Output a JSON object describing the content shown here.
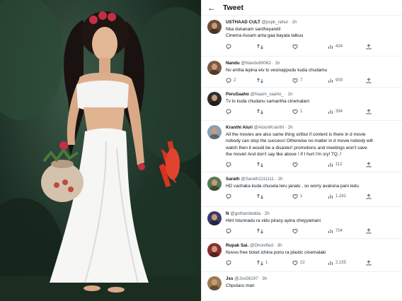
{
  "header": {
    "back_icon": "back-arrow-icon",
    "title": "Tweet"
  },
  "tweets": [
    {
      "name": "USTHAAD CULT",
      "handle": "@pspk_rahul",
      "time": "1h",
      "lines": [
        "Nka dukanam sardheyandi!",
        "Cinema Assam anta gaa bayata talkuu"
      ],
      "replies": "",
      "retweets": "",
      "likes": "",
      "views": "404",
      "avatar_color": "#6b4f3a"
    },
    {
      "name": "Nandu",
      "handle": "@Nandu80062",
      "time": "1h",
      "lines": [
        "Nv entha lepina etv lo vesinappudu kuda chudamu"
      ],
      "replies": "2",
      "retweets": "",
      "likes": "7",
      "views": "909",
      "avatar_color": "#7a5a44"
    },
    {
      "name": "PeruSaaho",
      "handle": "@Naam_saaho_",
      "time": "1h",
      "lines": [
        "Tv lo kuda chudanu samantha cinemalani"
      ],
      "replies": "",
      "retweets": "",
      "likes": "1",
      "views": "394",
      "avatar_color": "#2e2e2e"
    },
    {
      "name": "Kranthi Aluri",
      "handle": "@AlooriKranthi",
      "time": "2h",
      "lines": [
        "All the movies are also same thing sirlbut if content is there in d movie",
        "nobody can stop the success! Otherwise no matter in d movie nobody will",
        "watch then it would be a disaster! promotions and meetings won't save",
        "the movie! And don't say like above ! If I hurt I'm sry! TQ..!"
      ],
      "replies": "",
      "retweets": "",
      "likes": "",
      "views": "112",
      "avatar_color": "#8aa0b0"
    },
    {
      "name": "Sarath",
      "handle": "@Sarath1111111",
      "time": "2h",
      "lines": [
        "HD vachaka kuda chusela leru janalu , so worry avalsina pani ledu"
      ],
      "replies": "",
      "retweets": "",
      "likes": "1",
      "views": "1,161",
      "avatar_color": "#5a7a50"
    },
    {
      "name": "N",
      "handle": "@gothambidda",
      "time": "2h",
      "lines": [
        "Hint Istunnadu ra vidu piracy ayina cheyyamani"
      ],
      "replies": "",
      "retweets": "",
      "likes": "",
      "views": "704",
      "avatar_color": "#3a3a6a"
    },
    {
      "name": "Rupak Sai.",
      "handle": "@Dhonified",
      "time": "3h",
      "lines": [
        "Nuvvu free ticket ichina ponu ra plastic cinemalaki"
      ],
      "replies": "",
      "retweets": "1",
      "likes": "22",
      "views": "2,155",
      "avatar_color": "#8a3030"
    },
    {
      "name": "Jss",
      "handle": "@Jss56197",
      "time": "3h",
      "lines": [
        "Chputaru mari"
      ],
      "replies": "",
      "retweets": "",
      "likes": "",
      "views": "",
      "avatar_color": "#9a7a50"
    }
  ]
}
